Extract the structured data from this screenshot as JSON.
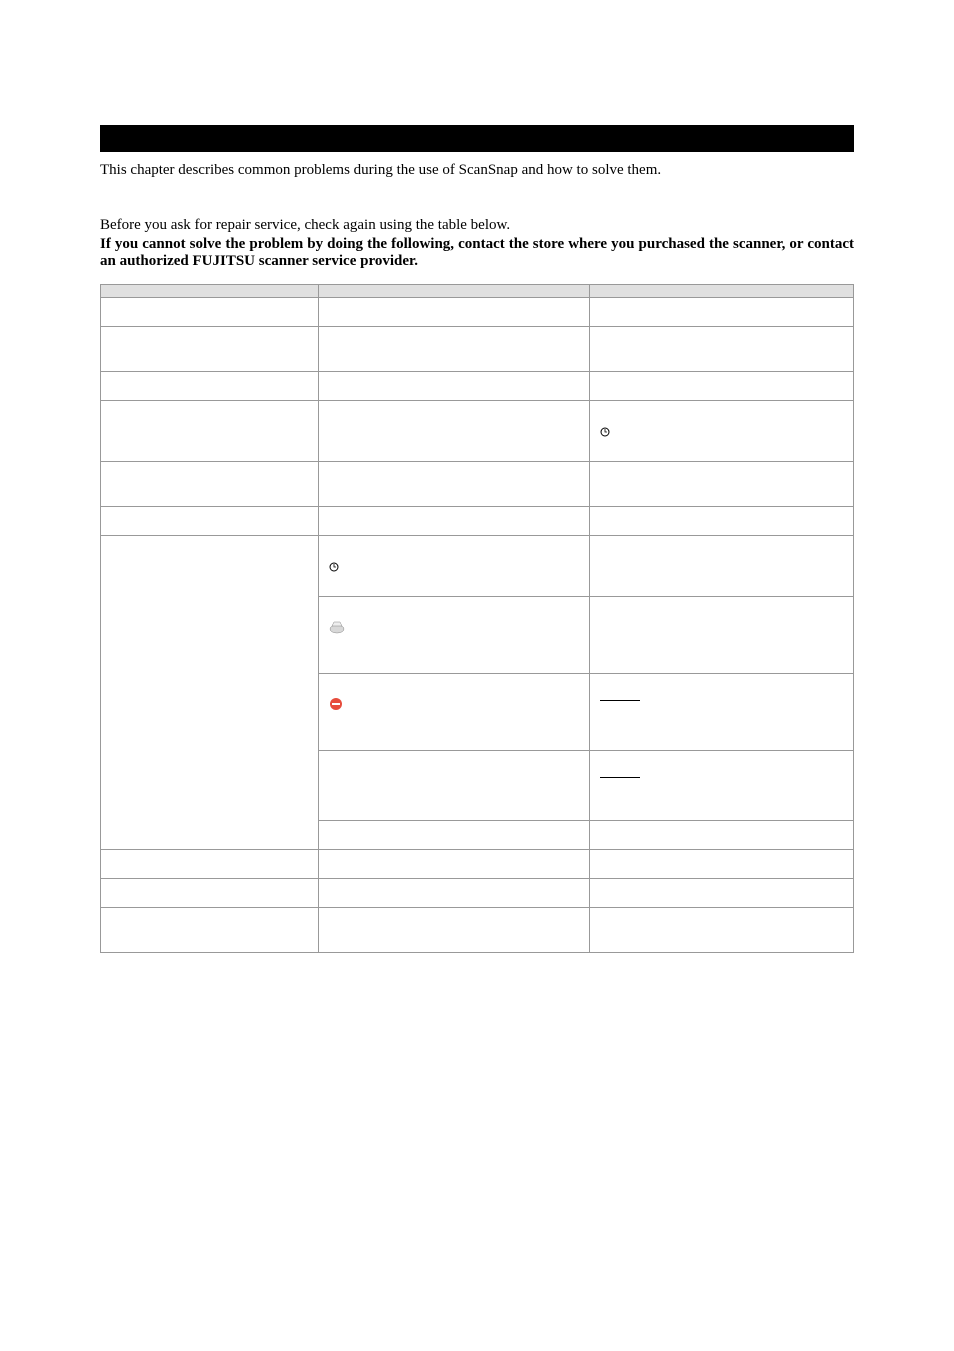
{
  "intro": "This chapter describes common problems during the use of ScanSnap and how to solve them.",
  "pre_note": "Before you ask for repair service, check again using the table below.",
  "bold_note": "If you cannot solve the problem by doing the following, contact the store where you purchased the scanner, or contact an authorized FUJITSU scanner service provider.",
  "headers": {
    "symptom": "",
    "check": "",
    "solution": ""
  },
  "rows": [
    {
      "symptom": "",
      "check": [
        {
          "t": " "
        }
      ],
      "solution": [
        {
          "t": " "
        }
      ]
    },
    {
      "symptom": "",
      "check": [
        {
          "t": " "
        },
        {
          "t": " "
        }
      ],
      "solution": [
        {
          "t": " "
        },
        {
          "t": " "
        }
      ]
    },
    {
      "symptom": "",
      "check": [
        {
          "t": " "
        }
      ],
      "solution": [
        {
          "t": " "
        }
      ]
    },
    {
      "symptom": "",
      "check": [
        {
          "t": " "
        }
      ],
      "solution": [
        {
          "t": " "
        },
        {
          "icon": "circle"
        },
        {
          "t": " "
        }
      ]
    },
    {
      "symptom": "",
      "check": [
        {
          "t": " "
        },
        {
          "t": " "
        }
      ],
      "solution": [
        {
          "t": " "
        },
        {
          "t": " "
        }
      ]
    },
    {
      "symptom": "",
      "check": [
        {
          "t": " "
        }
      ],
      "solution": [
        {
          "t": " "
        }
      ]
    },
    {
      "symptom_rowspan": 5,
      "symptom": "",
      "check": [
        {
          "t": " "
        },
        {
          "icon": "circle"
        },
        {
          "t": " "
        }
      ],
      "solution": [
        {
          "t": " "
        }
      ]
    },
    {
      "check": [
        {
          "t": " "
        },
        {
          "icon": "scanner"
        },
        {
          "t": " "
        },
        {
          "t": " "
        }
      ],
      "solution": [
        {
          "t": " "
        },
        {
          "t": " "
        }
      ]
    },
    {
      "check": [
        {
          "t": " "
        },
        {
          "icon": "redcircle"
        },
        {
          "t": " "
        },
        {
          "t": " "
        }
      ],
      "solution": [
        {
          "t": " "
        },
        {
          "hr": true
        },
        {
          "t": " "
        }
      ]
    },
    {
      "check": [
        {
          "t": " "
        },
        {
          "t": " "
        }
      ],
      "solution": [
        {
          "t": " "
        },
        {
          "hr": true
        },
        {
          "t": " "
        },
        {
          "t": " "
        }
      ]
    },
    {
      "check": [
        {
          "t": " "
        }
      ],
      "solution": [
        {
          "t": " "
        }
      ]
    },
    {
      "symptom": "",
      "check": [
        {
          "t": " "
        }
      ],
      "solution": [
        {
          "t": " "
        }
      ]
    },
    {
      "symptom": "",
      "check": [
        {
          "t": " "
        }
      ],
      "solution": [
        {
          "t": " "
        }
      ]
    },
    {
      "symptom": "",
      "check": [
        {
          "t": " "
        },
        {
          "t": " "
        }
      ],
      "solution": [
        {
          "t": " "
        }
      ]
    }
  ]
}
